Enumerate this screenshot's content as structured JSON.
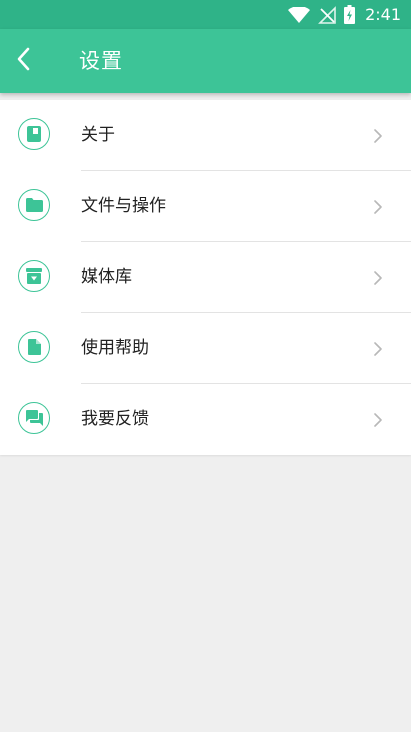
{
  "status_bar": {
    "time": "2:41",
    "icons": [
      "wifi-icon",
      "signal-off-icon",
      "battery-charging-icon"
    ]
  },
  "header": {
    "title": "设置",
    "back_icon": "back-arrow-icon"
  },
  "colors": {
    "status_bar": "#2fb388",
    "app_bar": "#3dc497",
    "accent": "#3dc497",
    "background": "#efefef"
  },
  "settings": {
    "items": [
      {
        "label": "关于",
        "icon": "book-icon"
      },
      {
        "label": "文件与操作",
        "icon": "folder-icon"
      },
      {
        "label": "媒体库",
        "icon": "archive-icon"
      },
      {
        "label": "使用帮助",
        "icon": "document-icon"
      },
      {
        "label": "我要反馈",
        "icon": "chat-icon"
      }
    ]
  }
}
